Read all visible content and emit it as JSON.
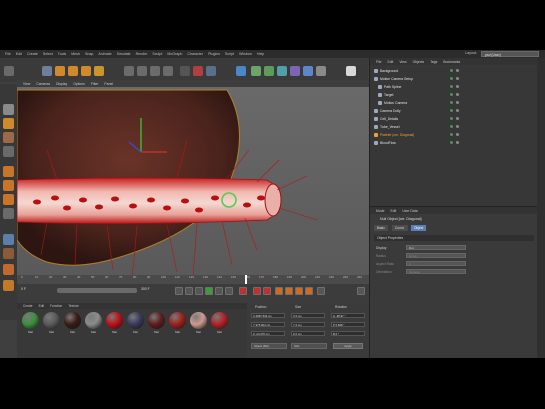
{
  "menubar": {
    "items": [
      "File",
      "Edit",
      "Create",
      "Select",
      "Tools",
      "Mesh",
      "Snap",
      "Animate",
      "Simulate",
      "Render",
      "Sculpt",
      "MoGraph",
      "Character",
      "Plugins",
      "Script",
      "Window",
      "Help"
    ],
    "layout_label": "Layout:",
    "layout_value": "psd (User)"
  },
  "viewport": {
    "menu": [
      "View",
      "Cameras",
      "Display",
      "Options",
      "Filter",
      "Panel"
    ]
  },
  "timeline": {
    "ticks": [
      "0",
      "10",
      "20",
      "30",
      "40",
      "50",
      "60",
      "70",
      "80",
      "90",
      "100",
      "110",
      "120",
      "130",
      "140",
      "150",
      "160",
      "170",
      "180",
      "190",
      "200",
      "210",
      "220",
      "230",
      "240"
    ],
    "start_frame": "0 F",
    "end_frame": "300 F"
  },
  "materials": {
    "menu": [
      "Create",
      "Edit",
      "Function",
      "Texture"
    ],
    "items": [
      {
        "label": "Mat",
        "color": "#3b8f3e"
      },
      {
        "label": "Mat",
        "color": "#5a5a5a"
      },
      {
        "label": "Mat",
        "color": "#3a1b16"
      },
      {
        "label": "Mat",
        "color": "#8c8c8c"
      },
      {
        "label": "Mat",
        "color": "#c0101a"
      },
      {
        "label": "Mat",
        "color": "#3b3b5a"
      },
      {
        "label": "Mat",
        "color": "#5e1e1c"
      },
      {
        "label": "Mat",
        "color": "#a0201e"
      },
      {
        "label": "Mat",
        "color": "#d09a90"
      },
      {
        "label": "Mat",
        "color": "#b52226"
      }
    ]
  },
  "coordinates": {
    "headers": [
      "Position",
      "Size",
      "Rotation"
    ],
    "rows": [
      [
        "X  2897.592 cm",
        "X  0 cm",
        "H  -98.97 °"
      ],
      [
        "Y  975.904 cm",
        "Y  0 cm",
        "P  0.828 °"
      ],
      [
        "Z  -24.376 cm",
        "Z  0 cm",
        "B  0 °"
      ]
    ],
    "mode_select": "Object (Rel)",
    "size_select": "Size",
    "apply_label": "Apply"
  },
  "objects": {
    "menu": [
      "File",
      "Edit",
      "View",
      "Objects",
      "Tags",
      "Bookmarks"
    ],
    "items": [
      {
        "label": "Background",
        "color": "#e0e0e0"
      },
      {
        "label": "Motion Camera Setup",
        "color": "#e0e0e0"
      },
      {
        "label": "Path Spline",
        "color": "#e0e0e0"
      },
      {
        "label": "Target",
        "color": "#e0e0e0"
      },
      {
        "label": "Motion Camera",
        "color": "#e0e0e0"
      },
      {
        "label": "Camera Dolly",
        "color": "#e0e0e0"
      },
      {
        "label": "Cell_Details",
        "color": "#e0e0e0"
      },
      {
        "label": "Tube_Vessel",
        "color": "#e0e0e0"
      },
      {
        "label": "Platelet (cer. Diagonal)",
        "color": "#f0a030"
      },
      {
        "label": "BloodFlow",
        "color": "#e0e0e0"
      }
    ]
  },
  "attributes": {
    "menu": [
      "Mode",
      "Edit",
      "User Data"
    ],
    "title": "Null Object [cer. Diagonal]",
    "tabs": [
      "Basic",
      "Coord.",
      "Object"
    ],
    "section": "Object Properties",
    "rows": [
      {
        "label": "Display",
        "value": "Dot"
      },
      {
        "label": "Radius",
        "value": "10 cm"
      },
      {
        "label": "Aspect Ratio",
        "value": "1"
      },
      {
        "label": "Orientation",
        "value": "Camera"
      }
    ]
  },
  "colors": {
    "accent": "#5b7fb5",
    "vessel_red": "#b01818",
    "liver_brown": "#5a2a22"
  }
}
